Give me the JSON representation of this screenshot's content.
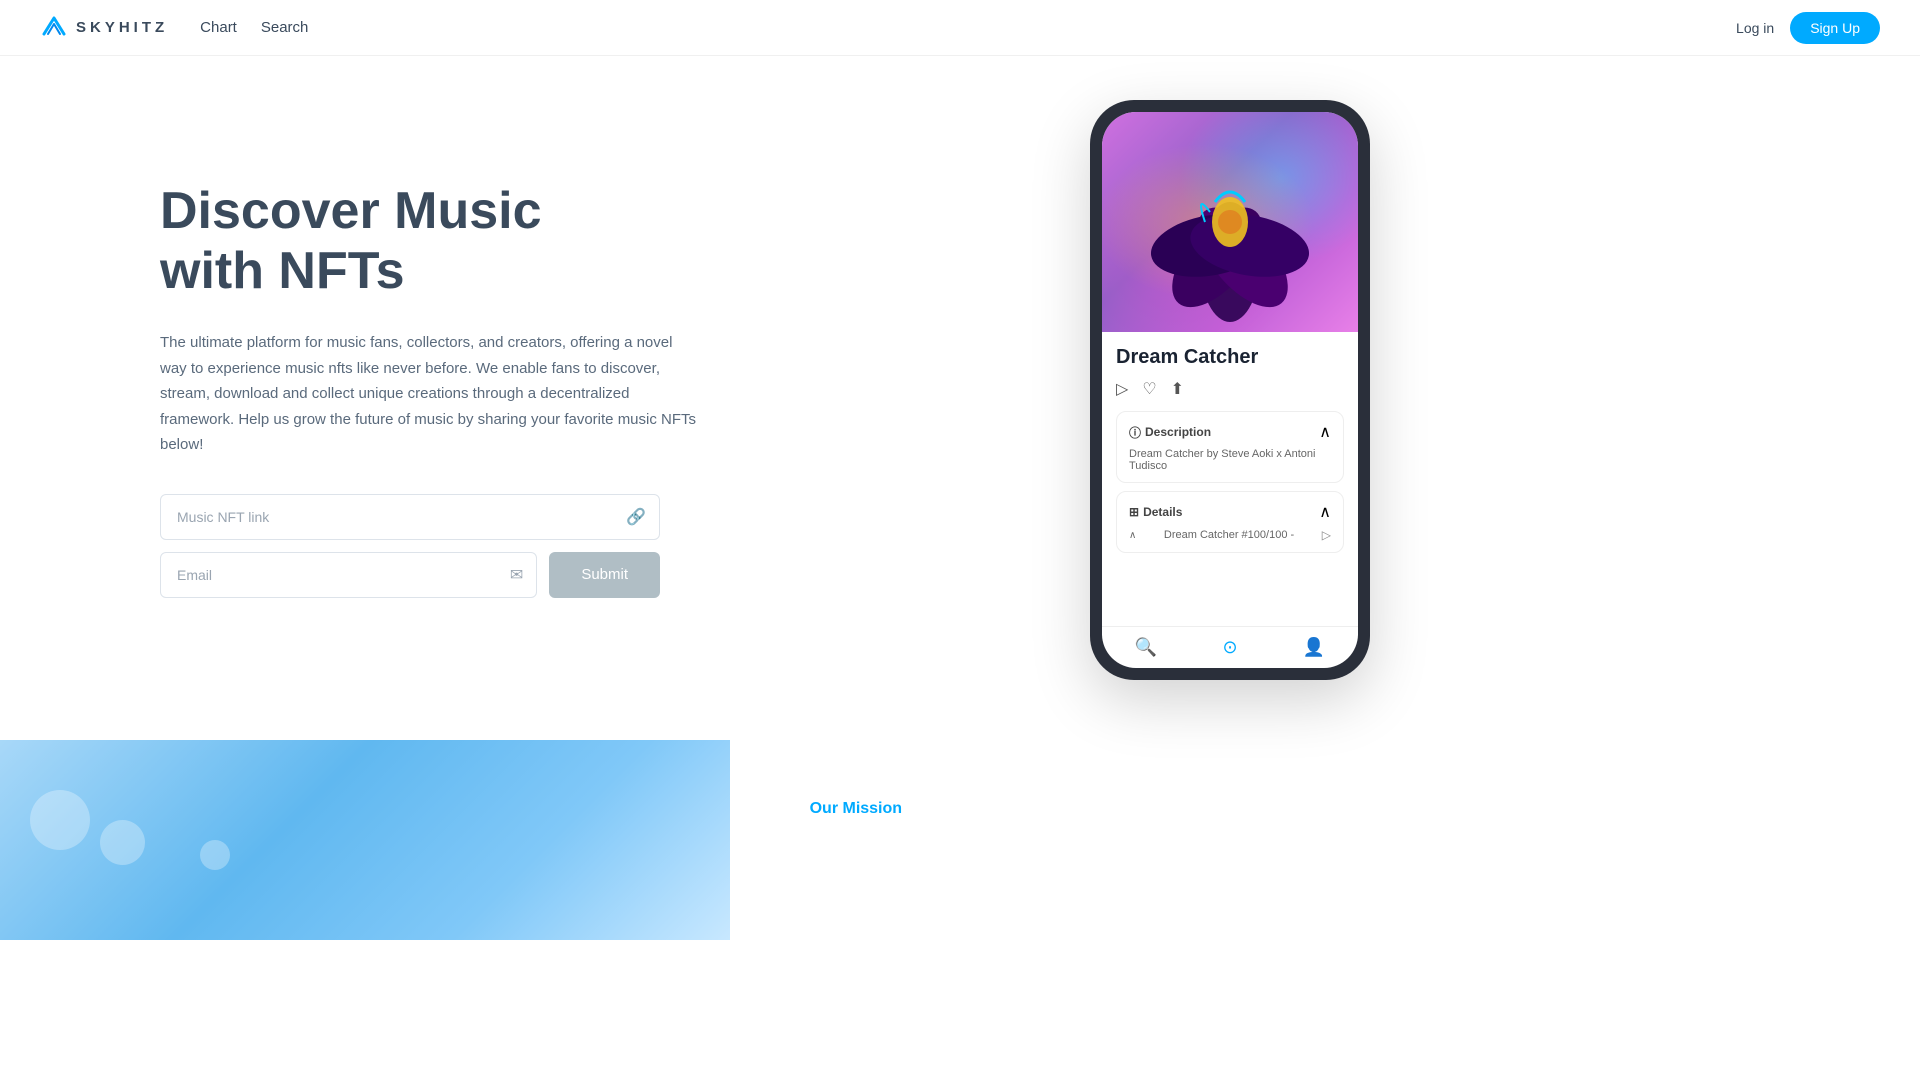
{
  "brand": {
    "name": "SKYHITZ",
    "logo_alt": "Skyhitz logo"
  },
  "nav": {
    "chart_label": "Chart",
    "search_label": "Search",
    "login_label": "Log in",
    "signup_label": "Sign Up"
  },
  "hero": {
    "title_line1": "Discover Music",
    "title_line2": "with NFTs",
    "description": "The ultimate platform for music fans, collectors, and creators, offering a novel way to experience music nfts like never before. We enable fans to discover, stream, download and collect unique creations through a decentralized framework.  Help us grow the future of music by sharing your favorite music NFTs below!",
    "nft_link_placeholder": "Music NFT link",
    "email_placeholder": "Email",
    "submit_label": "Submit"
  },
  "phone": {
    "nft_title": "Dream Catcher",
    "description_section_title": "Description",
    "description_content": "Dream Catcher by Steve Aoki x Antoni Tudisco",
    "details_section_title": "Details",
    "details_content": "Dream Catcher #100/100 -"
  },
  "bottom": {
    "our_mission_label": "Our Mission"
  }
}
